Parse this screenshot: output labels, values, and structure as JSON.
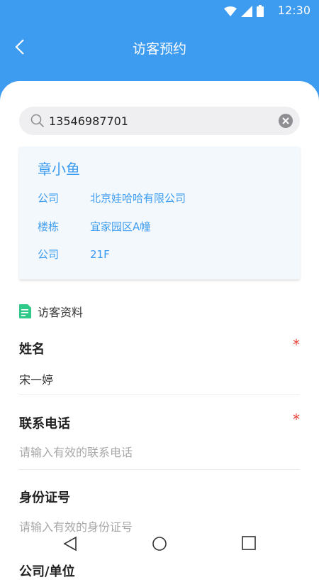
{
  "status_bar": {
    "time": "12:30"
  },
  "header": {
    "title": "访客预约"
  },
  "search": {
    "value": "13546987701"
  },
  "host_card": {
    "name": "章小鱼",
    "rows": [
      {
        "label": "公司",
        "value": "北京娃哈哈有限公司"
      },
      {
        "label": "楼栋",
        "value": "宜家园区A幢"
      },
      {
        "label": "公司",
        "value": "21F"
      }
    ]
  },
  "visitor_section": {
    "title": "访客资料",
    "fields": [
      {
        "label": "姓名",
        "required_mark": "*",
        "value": "宋一婷"
      },
      {
        "label": "联系电话",
        "required_mark": "*",
        "placeholder": "请输入有效的联系电话"
      },
      {
        "label": "身份证号",
        "placeholder": "请输入有效的身份证号"
      },
      {
        "label": "公司/单位"
      }
    ]
  },
  "colors": {
    "accent": "#3d9cf0",
    "required": "#e8443b",
    "card_bg": "#f3f8fd"
  },
  "icons": [
    "back-arrow-icon",
    "search-icon",
    "clear-icon",
    "document-icon",
    "wifi-icon",
    "signal-icon",
    "battery-icon",
    "back-nav-icon",
    "home-nav-icon",
    "recents-nav-icon"
  ]
}
